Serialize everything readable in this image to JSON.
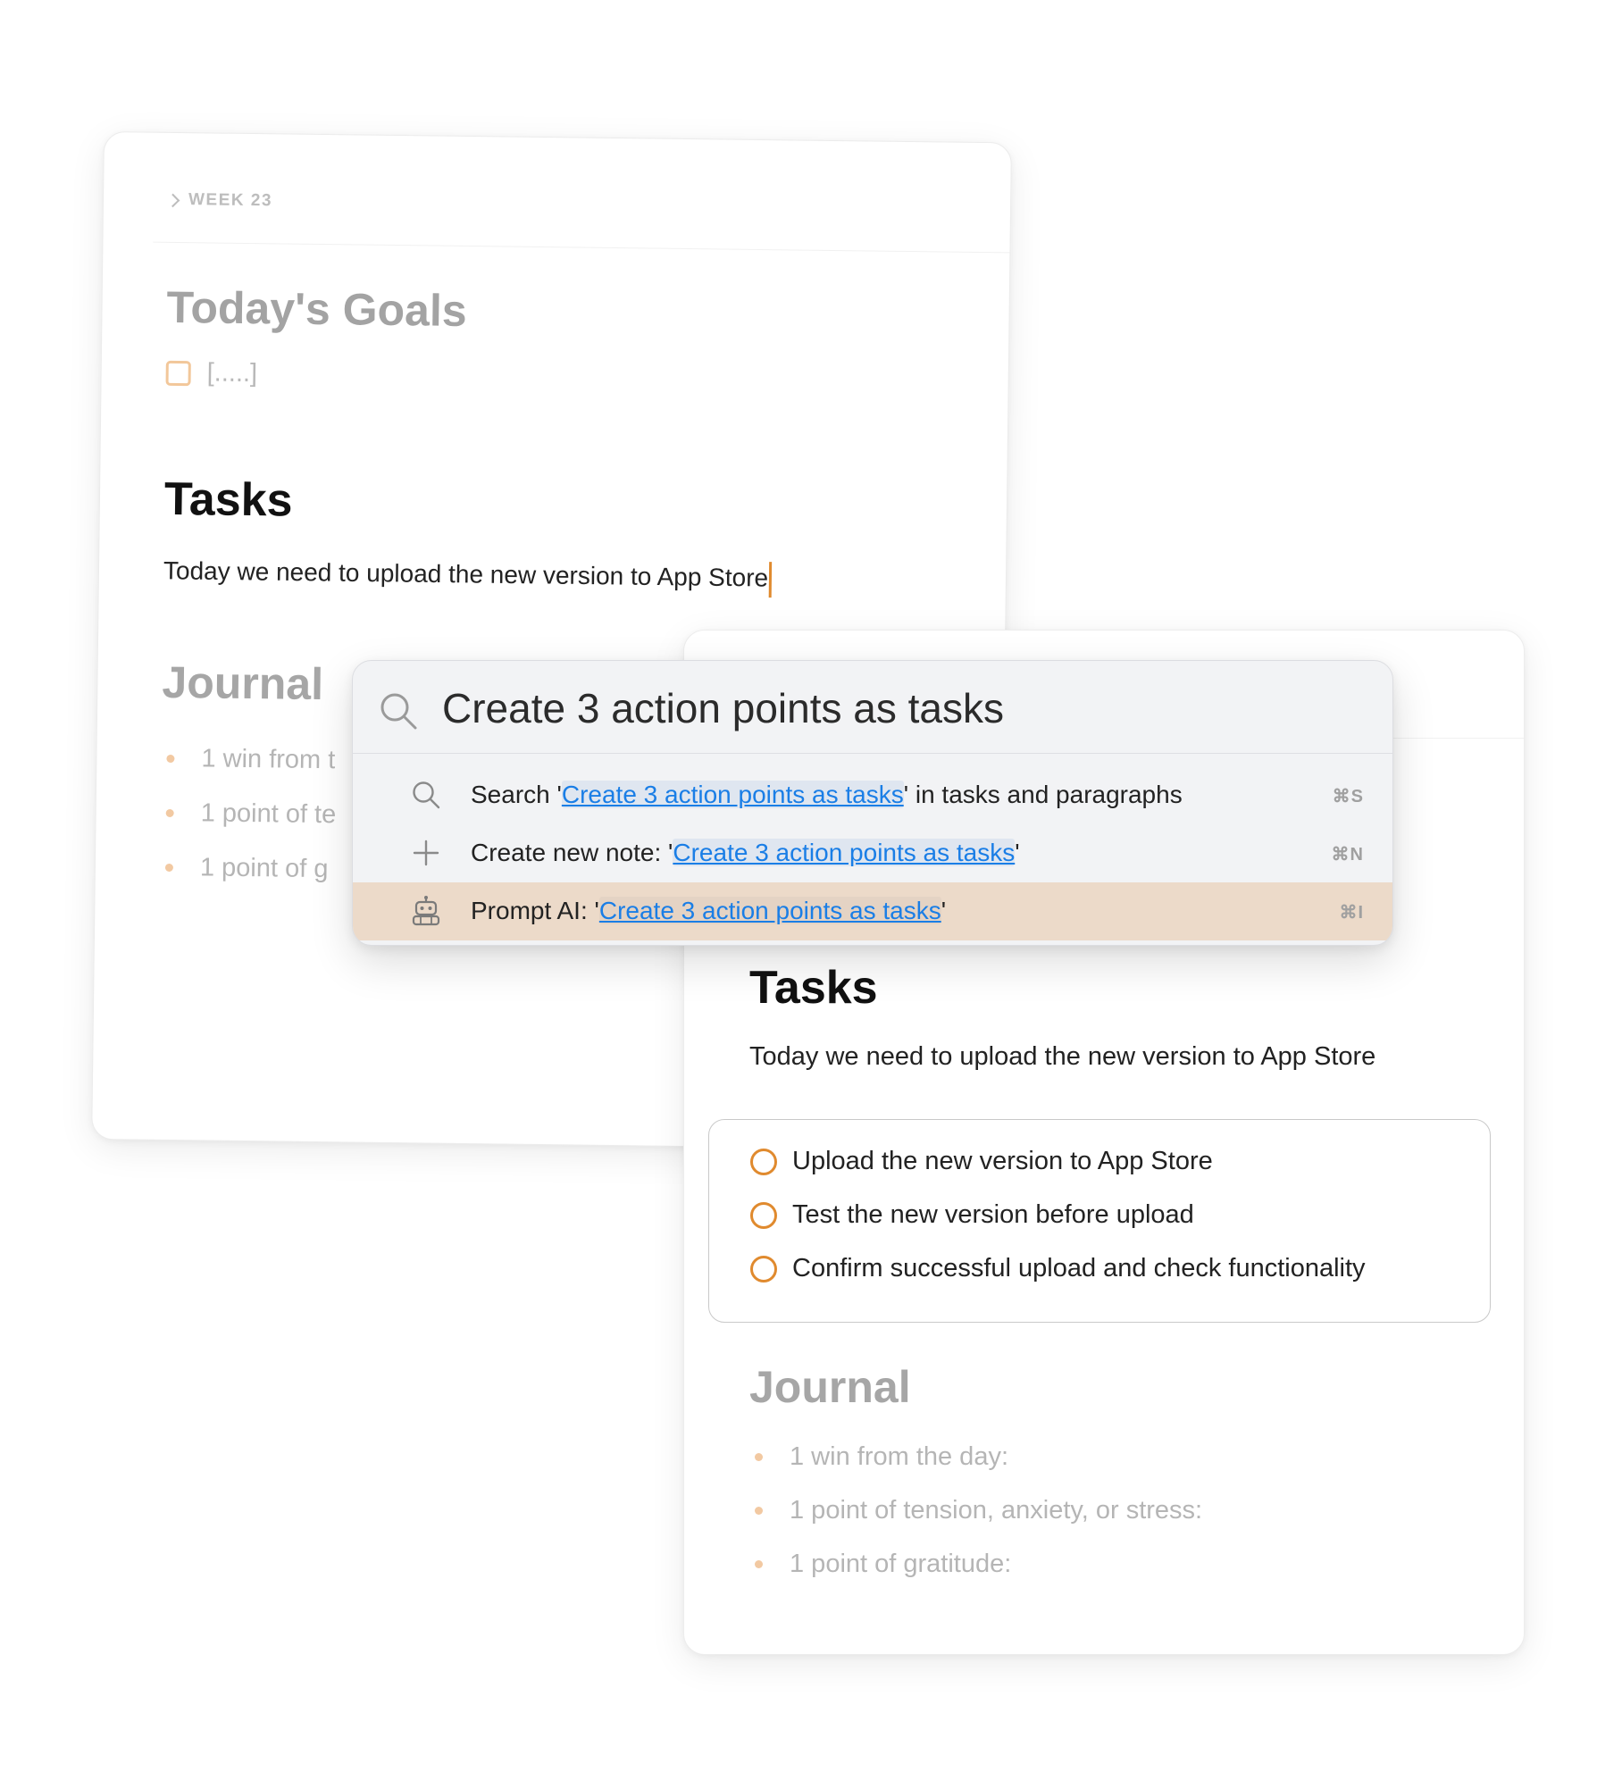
{
  "back_note": {
    "breadcrumb": "WEEK 23",
    "goals_title": "Today's Goals",
    "goal_placeholder": "[.....]",
    "tasks_title": "Tasks",
    "tasks_text": "Today we need to upload the new version to App Store",
    "journal_title": "Journal",
    "journal_items": [
      {
        "label": "1 win from t"
      },
      {
        "label": "1 point of te"
      },
      {
        "label": "1 point of g"
      }
    ]
  },
  "command_palette": {
    "query": "Create 3 action points as tasks",
    "options": [
      {
        "icon": "search-icon",
        "prefix": "Search '",
        "query": "Create 3 action points as tasks",
        "suffix": "' in tasks and paragraphs",
        "shortcut": "⌘S"
      },
      {
        "icon": "plus-icon",
        "prefix": "Create new note: '",
        "query": "Create 3 action points as tasks",
        "suffix": "'",
        "shortcut": "⌘N"
      },
      {
        "icon": "robot-icon",
        "prefix": "Prompt AI: '",
        "query": "Create 3 action points as tasks",
        "suffix": "'",
        "shortcut": "⌘I",
        "selected": true
      }
    ]
  },
  "front_note": {
    "tasks_title": "Tasks",
    "tasks_text": "Today we need to upload the new version to App Store",
    "generated_tasks": [
      {
        "label": "Upload the new version to App Store"
      },
      {
        "label": "Test the new version before upload"
      },
      {
        "label": "Confirm successful upload and check functionality"
      }
    ],
    "journal_title": "Journal",
    "journal_items": [
      {
        "label": "1 win from the day:"
      },
      {
        "label": "1 point of tension, anxiety, or stress:"
      },
      {
        "label": "1 point of gratitude:"
      }
    ]
  },
  "colors": {
    "accent_orange": "#e08a2e",
    "link_blue": "#1a7ee6",
    "selected_row": "#ecdac9"
  }
}
